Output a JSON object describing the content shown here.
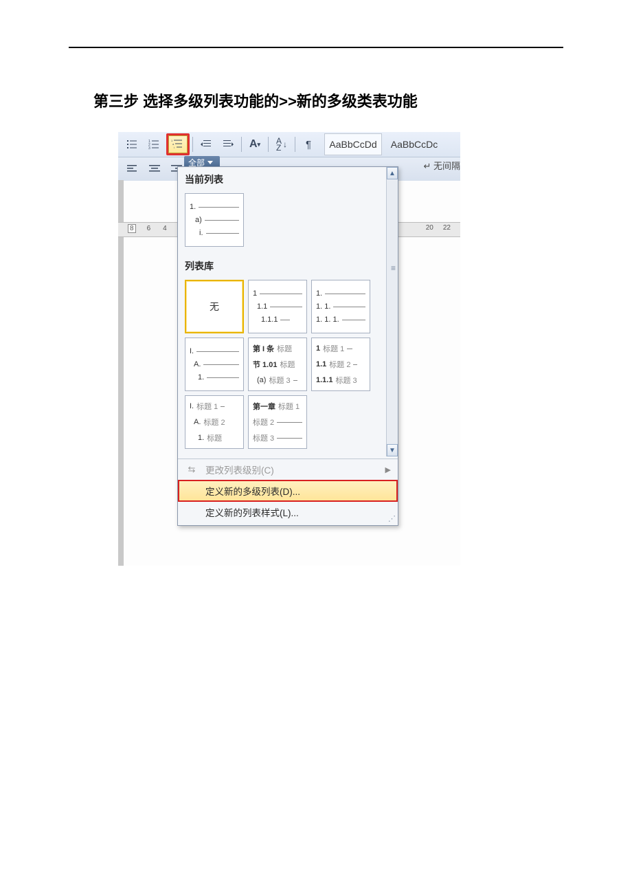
{
  "step_title": "第三步    选择多级列表功能的>>新的多级类表功能",
  "ribbon": {
    "style1": "AaBbCcDd",
    "style2": "AaBbCcDc",
    "style_sub": "↵ 无间隔"
  },
  "tab_all": "全部",
  "ruler": {
    "left_marks": [
      "8",
      "6",
      "4"
    ],
    "right_marks": [
      "20",
      "22"
    ]
  },
  "dropdown": {
    "section_current": "当前列表",
    "current_lines": [
      "1.",
      "a)",
      "i."
    ],
    "section_library": "列表库",
    "lib": {
      "none": "无",
      "b": [
        "1",
        "1.1",
        "1.1.1"
      ],
      "c": [
        "1.",
        "1. 1.",
        "1. 1. 1."
      ],
      "d": [
        "I.",
        "A.",
        "1."
      ],
      "e": {
        "l1_a": "第 I 条",
        "l1_b": "标题",
        "l2_a": "节 1.01",
        "l2_b": "标题",
        "l3_a": "(a)",
        "l3_b": "标题 3"
      },
      "f": {
        "l1_a": "1",
        "l1_b": "标题 1",
        "l2_a": "1.1",
        "l2_b": "标题 2",
        "l3_a": "1.1.1",
        "l3_b": "标题 3"
      },
      "g": {
        "l1_a": "I.",
        "l1_b": "标题 1",
        "l2_a": "A.",
        "l2_b": "标题 2",
        "l3_a": "1.",
        "l3_b": "标题"
      },
      "h": {
        "l1_a": "第一章",
        "l1_b": "标题 1",
        "l2_a": "标题 2",
        "l3_a": "标题 3"
      }
    },
    "menu": {
      "change_level": "更改列表级别(C)",
      "define_multilevel": "定义新的多级列表(D)...",
      "define_style": "定义新的列表样式(L)..."
    }
  }
}
